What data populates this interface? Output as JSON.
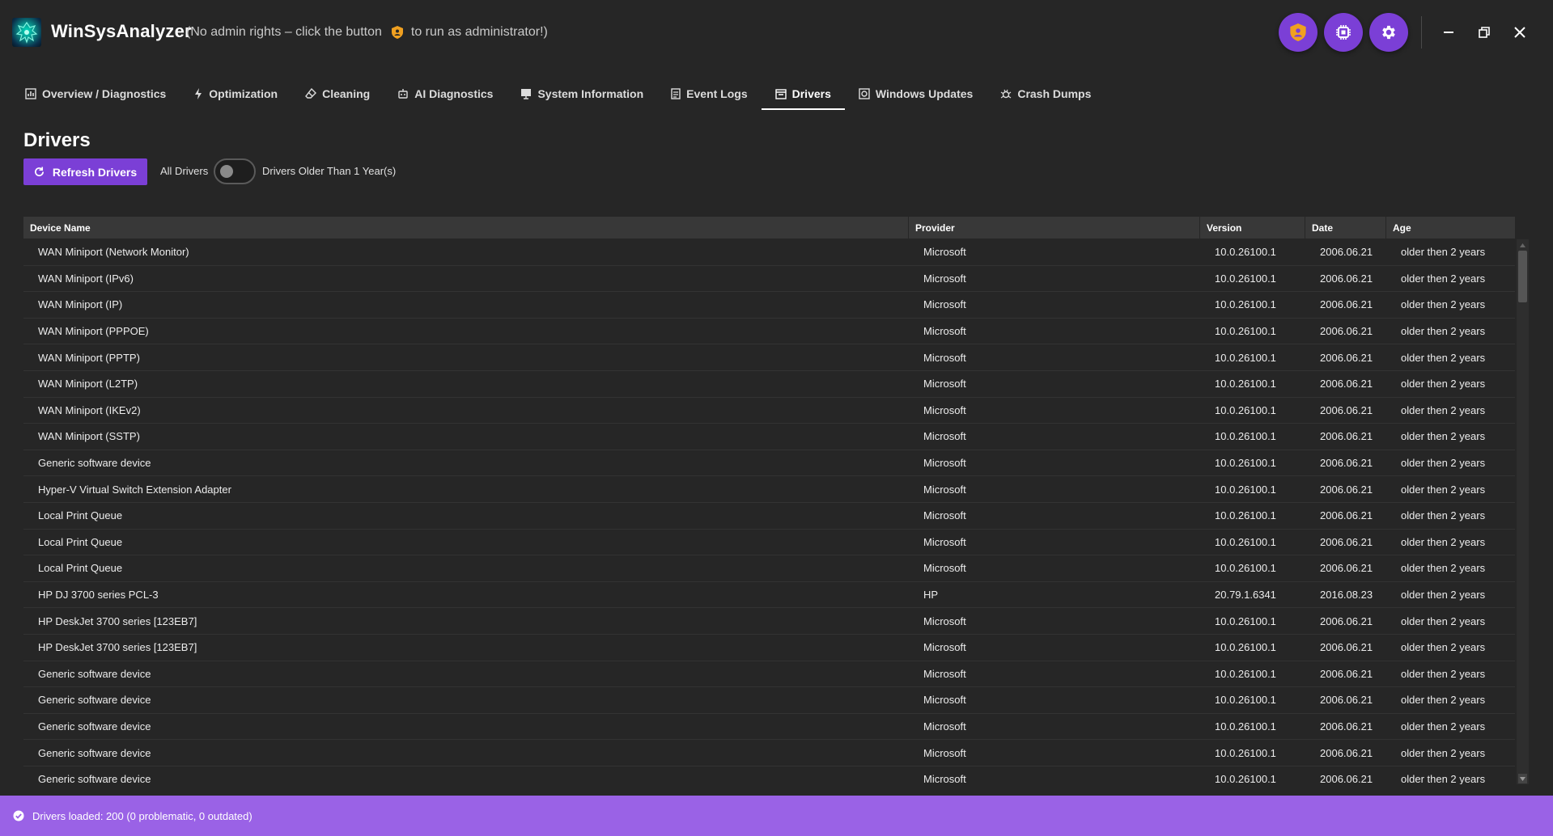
{
  "app": {
    "title": "WinSysAnalyzer",
    "admin_note_before": "(No admin rights – click the button",
    "admin_note_after": "to run as administrator!)"
  },
  "header_actions": [
    {
      "icon": "shield-user-icon",
      "action": "run-as-admin"
    },
    {
      "icon": "cpu-chip-icon",
      "action": "hardware"
    },
    {
      "icon": "gear-icon",
      "action": "settings"
    }
  ],
  "window_controls": [
    "minimize-icon",
    "restore-icon",
    "close-icon"
  ],
  "tabs": [
    {
      "label": "Overview / Diagnostics",
      "icon": "chart-icon"
    },
    {
      "label": "Optimization",
      "icon": "lightning-icon"
    },
    {
      "label": "Cleaning",
      "icon": "eraser-icon"
    },
    {
      "label": "AI Diagnostics",
      "icon": "robot-icon"
    },
    {
      "label": "System Information",
      "icon": "monitor-icon"
    },
    {
      "label": "Event Logs",
      "icon": "document-icon"
    },
    {
      "label": "Drivers",
      "icon": "calendar-box-icon",
      "active": true
    },
    {
      "label": "Windows Updates",
      "icon": "update-icon"
    },
    {
      "label": "Crash Dumps",
      "icon": "bug-icon"
    }
  ],
  "page": {
    "title": "Drivers",
    "refresh_label": "Refresh Drivers",
    "filter_left": "All Drivers",
    "filter_right": "Drivers Older Than 1 Year(s)",
    "toggle_on": false
  },
  "table": {
    "columns": [
      "Device Name",
      "Provider",
      "Version",
      "Date",
      "Age"
    ],
    "rows": [
      [
        "WAN Miniport (Network Monitor)",
        "Microsoft",
        "10.0.26100.1",
        "2006.06.21",
        "older then 2 years"
      ],
      [
        "WAN Miniport (IPv6)",
        "Microsoft",
        "10.0.26100.1",
        "2006.06.21",
        "older then 2 years"
      ],
      [
        "WAN Miniport (IP)",
        "Microsoft",
        "10.0.26100.1",
        "2006.06.21",
        "older then 2 years"
      ],
      [
        "WAN Miniport (PPPOE)",
        "Microsoft",
        "10.0.26100.1",
        "2006.06.21",
        "older then 2 years"
      ],
      [
        "WAN Miniport (PPTP)",
        "Microsoft",
        "10.0.26100.1",
        "2006.06.21",
        "older then 2 years"
      ],
      [
        "WAN Miniport (L2TP)",
        "Microsoft",
        "10.0.26100.1",
        "2006.06.21",
        "older then 2 years"
      ],
      [
        "WAN Miniport (IKEv2)",
        "Microsoft",
        "10.0.26100.1",
        "2006.06.21",
        "older then 2 years"
      ],
      [
        "WAN Miniport (SSTP)",
        "Microsoft",
        "10.0.26100.1",
        "2006.06.21",
        "older then 2 years"
      ],
      [
        "Generic software device",
        "Microsoft",
        "10.0.26100.1",
        "2006.06.21",
        "older then 2 years"
      ],
      [
        "Hyper-V Virtual Switch Extension Adapter",
        "Microsoft",
        "10.0.26100.1",
        "2006.06.21",
        "older then 2 years"
      ],
      [
        "Local Print Queue",
        "Microsoft",
        "10.0.26100.1",
        "2006.06.21",
        "older then 2 years"
      ],
      [
        "Local Print Queue",
        "Microsoft",
        "10.0.26100.1",
        "2006.06.21",
        "older then 2 years"
      ],
      [
        "Local Print Queue",
        "Microsoft",
        "10.0.26100.1",
        "2006.06.21",
        "older then 2 years"
      ],
      [
        "HP DJ 3700 series PCL-3",
        "HP",
        "20.79.1.6341",
        "2016.08.23",
        "older then 2 years"
      ],
      [
        "HP DeskJet 3700 series [123EB7]",
        "Microsoft",
        "10.0.26100.1",
        "2006.06.21",
        "older then 2 years"
      ],
      [
        "HP DeskJet 3700 series [123EB7]",
        "Microsoft",
        "10.0.26100.1",
        "2006.06.21",
        "older then 2 years"
      ],
      [
        "Generic software device",
        "Microsoft",
        "10.0.26100.1",
        "2006.06.21",
        "older then 2 years"
      ],
      [
        "Generic software device",
        "Microsoft",
        "10.0.26100.1",
        "2006.06.21",
        "older then 2 years"
      ],
      [
        "Generic software device",
        "Microsoft",
        "10.0.26100.1",
        "2006.06.21",
        "older then 2 years"
      ],
      [
        "Generic software device",
        "Microsoft",
        "10.0.26100.1",
        "2006.06.21",
        "older then 2 years"
      ],
      [
        "Generic software device",
        "Microsoft",
        "10.0.26100.1",
        "2006.06.21",
        "older then 2 years"
      ]
    ]
  },
  "status": {
    "text": "Drivers loaded: 200 (0 problematic, 0 outdated)",
    "icon": "check-circle-icon"
  },
  "colors": {
    "accent": "#7b3fd6",
    "status_bar": "#9a62e6",
    "background": "#262626",
    "header_row": "#383838",
    "warning_shield": "#f0a020"
  }
}
